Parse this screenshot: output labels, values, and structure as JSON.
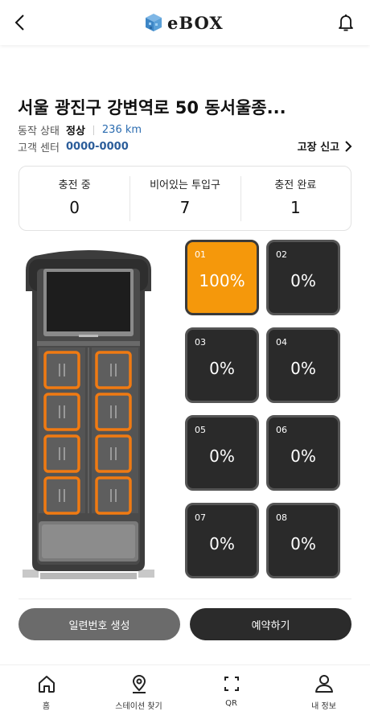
{
  "header": {
    "logo_text": "eBOX"
  },
  "station": {
    "title": "서울 광진구 강변역로 50 동서울종...",
    "status_label": "동작 상태",
    "status_value": "정상",
    "distance": "236 km",
    "support_label": "고객 센터",
    "support_phone": "0000-0000",
    "report_label": "고장 신고"
  },
  "stats": [
    {
      "label": "충전 중",
      "value": "0"
    },
    {
      "label": "비어있는 투입구",
      "value": "7"
    },
    {
      "label": "충전 완료",
      "value": "1"
    }
  ],
  "slots": [
    {
      "num": "01",
      "pct": "100%",
      "active": true
    },
    {
      "num": "02",
      "pct": "0%",
      "active": false
    },
    {
      "num": "03",
      "pct": "0%",
      "active": false
    },
    {
      "num": "04",
      "pct": "0%",
      "active": false
    },
    {
      "num": "05",
      "pct": "0%",
      "active": false
    },
    {
      "num": "06",
      "pct": "0%",
      "active": false
    },
    {
      "num": "07",
      "pct": "0%",
      "active": false
    },
    {
      "num": "08",
      "pct": "0%",
      "active": false
    }
  ],
  "actions": {
    "serial_label": "일련번호 생성",
    "reserve_label": "예약하기"
  },
  "tabs": [
    {
      "label": "홈",
      "icon": "home-icon"
    },
    {
      "label": "스테이션 찾기",
      "icon": "location-pin-icon"
    },
    {
      "label": "QR",
      "icon": "qr-scan-icon"
    },
    {
      "label": "내 정보",
      "icon": "user-icon"
    }
  ],
  "colors": {
    "accent": "#f5980b",
    "slot_dark": "#2a2a2a",
    "link_blue": "#2b5d9a"
  }
}
